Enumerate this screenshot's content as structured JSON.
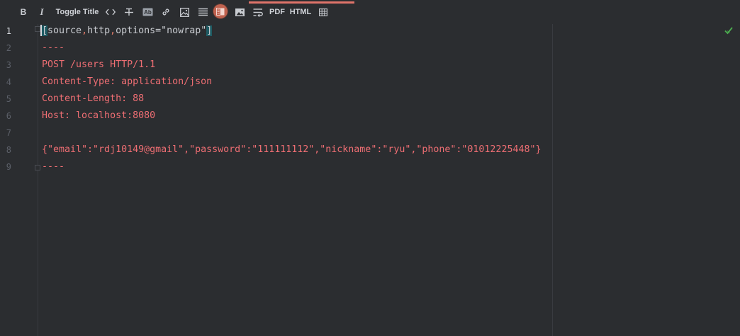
{
  "toolbar": {
    "bold_label": "B",
    "italic_label": "I",
    "toggle_title_label": "Toggle Title",
    "pdf_label": "PDF",
    "html_label": "HTML",
    "accent_color": "#e0746a",
    "icons": [
      "bold-icon",
      "italic-icon",
      "code-icon",
      "strikethrough-icon",
      "ab-icon",
      "link-icon",
      "image-icon",
      "list-icon",
      "preview-toggle-icon",
      "picture-icon",
      "wrap-icon",
      "table-icon"
    ]
  },
  "editor": {
    "lines": [
      {
        "num": "1",
        "text": "[source,http,options=\"nowrap\"]"
      },
      {
        "num": "2",
        "text": "----"
      },
      {
        "num": "3",
        "text": "POST /users HTTP/1.1"
      },
      {
        "num": "4",
        "text": "Content-Type: application/json"
      },
      {
        "num": "5",
        "text": "Content-Length: 88"
      },
      {
        "num": "6",
        "text": "Host: localhost:8080"
      },
      {
        "num": "7",
        "text": ""
      },
      {
        "num": "8",
        "text": "{\"email\":\"rdj10149@gmail\",\"password\":\"111111112\",\"nickname\":\"ryu\",\"phone\":\"01012225448\"}"
      },
      {
        "num": "9",
        "text": "----"
      }
    ],
    "line1_parts": {
      "open": "[",
      "source": "source",
      "comma1": ",",
      "http": "http",
      "comma2": ",",
      "options": "options=\"nowrap\"",
      "close": "]"
    },
    "status_icon": "check-icon",
    "status_color": "#4caf50"
  }
}
